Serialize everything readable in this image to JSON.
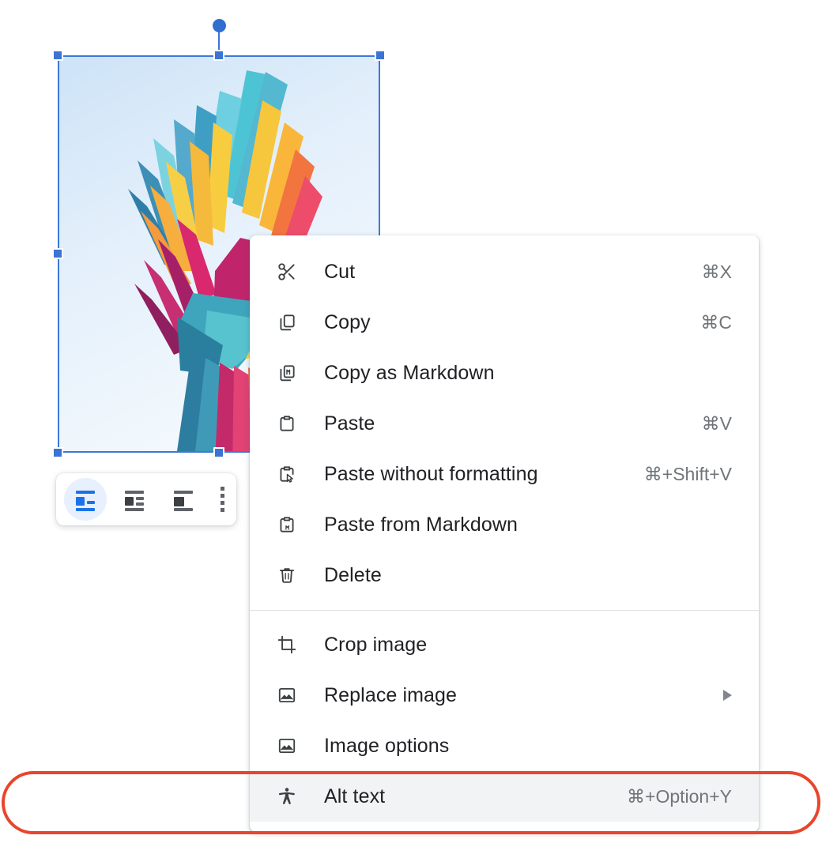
{
  "document": {
    "app": "google-docs-image-context-menu",
    "image": {
      "alt_description": "Colorful paper-craft style flying bird illustration on a light blue background",
      "selected": true,
      "selection_color": "#3b74d4",
      "background_gradient_start": "#cfe4f7",
      "background_gradient_end": "#f1f8fd"
    }
  },
  "wrap_toolbar": {
    "options": [
      {
        "name": "wrap-text",
        "label": "Wrap text",
        "selected": true
      },
      {
        "name": "break-text",
        "label": "Break text",
        "selected": false
      },
      {
        "name": "behind-text",
        "label": "Behind text",
        "selected": false
      }
    ],
    "more_label": "More image options",
    "active_color": "#1a73e8",
    "active_background": "#e8f0fe"
  },
  "context_menu": {
    "groups": [
      {
        "items": [
          {
            "icon": "scissors-icon",
            "label": "Cut",
            "shortcut": "⌘X",
            "submenu": false,
            "highlighted": false
          },
          {
            "icon": "copy-icon",
            "label": "Copy",
            "shortcut": "⌘C",
            "submenu": false,
            "highlighted": false
          },
          {
            "icon": "copy-markdown-icon",
            "label": "Copy as Markdown",
            "shortcut": "",
            "submenu": false,
            "highlighted": false
          },
          {
            "icon": "clipboard-icon",
            "label": "Paste",
            "shortcut": "⌘V",
            "submenu": false,
            "highlighted": false
          },
          {
            "icon": "paste-plain-icon",
            "label": "Paste without formatting",
            "shortcut": "⌘+Shift+V",
            "submenu": false,
            "highlighted": false
          },
          {
            "icon": "paste-markdown-icon",
            "label": "Paste from Markdown",
            "shortcut": "",
            "submenu": false,
            "highlighted": false
          },
          {
            "icon": "trash-icon",
            "label": "Delete",
            "shortcut": "",
            "submenu": false,
            "highlighted": false
          }
        ]
      },
      {
        "items": [
          {
            "icon": "crop-icon",
            "label": "Crop image",
            "shortcut": "",
            "submenu": false,
            "highlighted": false
          },
          {
            "icon": "image-icon",
            "label": "Replace image",
            "shortcut": "",
            "submenu": true,
            "highlighted": false
          },
          {
            "icon": "image-icon",
            "label": "Image options",
            "shortcut": "",
            "submenu": false,
            "highlighted": false
          },
          {
            "icon": "accessibility-icon",
            "label": "Alt text",
            "shortcut": "⌘+Option+Y",
            "submenu": false,
            "highlighted": true
          }
        ]
      }
    ],
    "highlight_ring_color": "#e8452c",
    "highlighted_row_background": "#f1f3f4"
  }
}
